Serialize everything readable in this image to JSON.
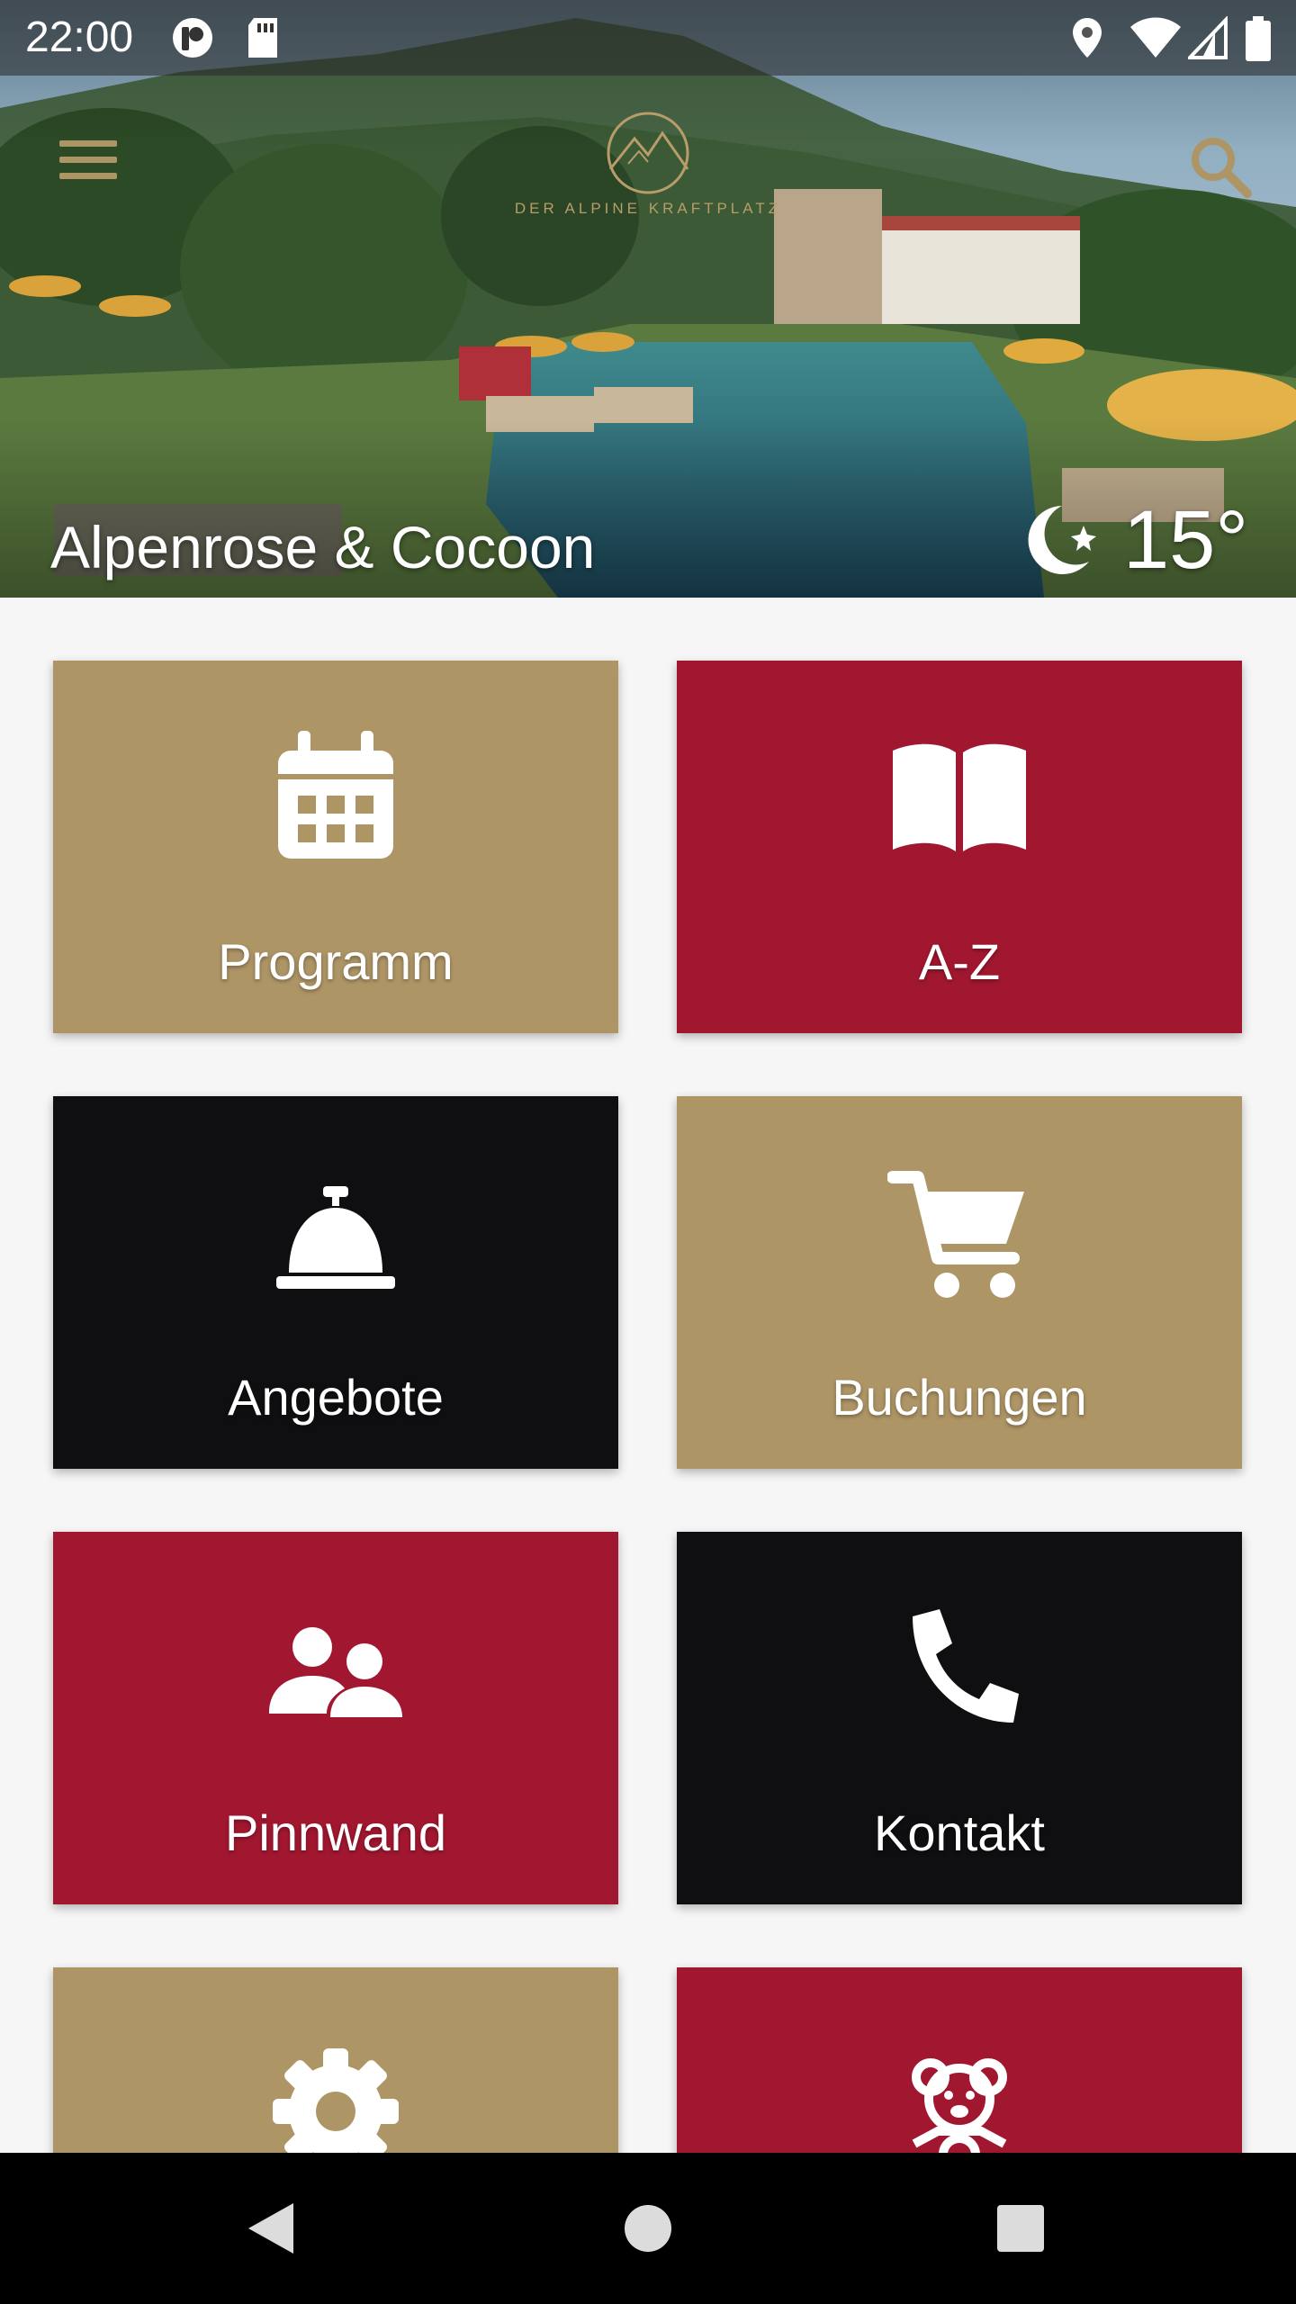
{
  "status_bar": {
    "time": "22:00"
  },
  "hero": {
    "hotel_name": "Alpenrose & Cocoon",
    "logo_text": "DER ALPINE KRAFTPLATZ",
    "weather": {
      "icon": "moon-star-icon",
      "temperature": "15°"
    }
  },
  "theme": {
    "gold": "#ae9566",
    "red": "#a21730",
    "black": "#0f0f11"
  },
  "tiles": [
    {
      "label": "Programm",
      "icon": "calendar-icon",
      "color": "gold"
    },
    {
      "label": "A-Z",
      "icon": "book-open-icon",
      "color": "red"
    },
    {
      "label": "Angebote",
      "icon": "service-bell-icon",
      "color": "black"
    },
    {
      "label": "Buchungen",
      "icon": "shopping-cart-icon",
      "color": "gold"
    },
    {
      "label": "Pinnwand",
      "icon": "users-icon",
      "color": "red"
    },
    {
      "label": "Kontakt",
      "icon": "phone-icon",
      "color": "black"
    },
    {
      "label": "",
      "icon": "gear-icon",
      "color": "gold"
    },
    {
      "label": "",
      "icon": "teddy-bear-icon",
      "color": "red"
    }
  ]
}
